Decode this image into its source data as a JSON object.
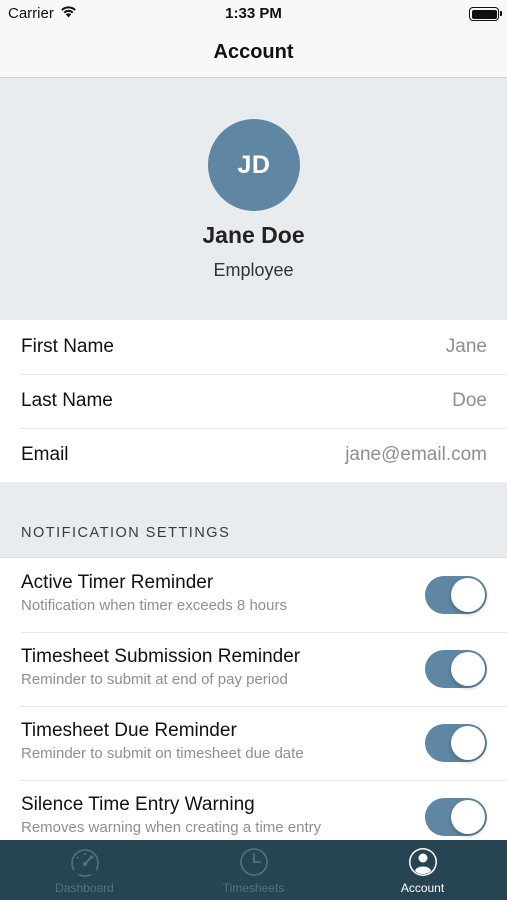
{
  "status_bar": {
    "carrier": "Carrier",
    "time": "1:33 PM"
  },
  "nav": {
    "title": "Account"
  },
  "profile": {
    "initials": "JD",
    "name": "Jane Doe",
    "role": "Employee",
    "avatar_color": "#5f87a3"
  },
  "info_rows": [
    {
      "label": "First Name",
      "value": "Jane"
    },
    {
      "label": "Last Name",
      "value": "Doe"
    },
    {
      "label": "Email",
      "value": "jane@email.com"
    }
  ],
  "notifications": {
    "header": "NOTIFICATION SETTINGS",
    "items": [
      {
        "title": "Active Timer Reminder",
        "subtitle": "Notification when timer exceeds 8 hours",
        "enabled": true
      },
      {
        "title": "Timesheet Submission Reminder",
        "subtitle": "Reminder to submit at end of pay period",
        "enabled": true
      },
      {
        "title": "Timesheet Due Reminder",
        "subtitle": "Reminder to submit on timesheet due date",
        "enabled": true
      },
      {
        "title": "Silence Time Entry Warning",
        "subtitle": "Removes warning when creating a time entry",
        "enabled": true
      }
    ]
  },
  "tabs": [
    {
      "label": "Dashboard",
      "icon": "dashboard-icon",
      "active": false
    },
    {
      "label": "Timesheets",
      "icon": "clock-icon",
      "active": false
    },
    {
      "label": "Account",
      "icon": "account-icon",
      "active": true
    }
  ],
  "colors": {
    "accent": "#5f87a3",
    "tab_bar": "#274452",
    "background": "#e8ecef"
  }
}
